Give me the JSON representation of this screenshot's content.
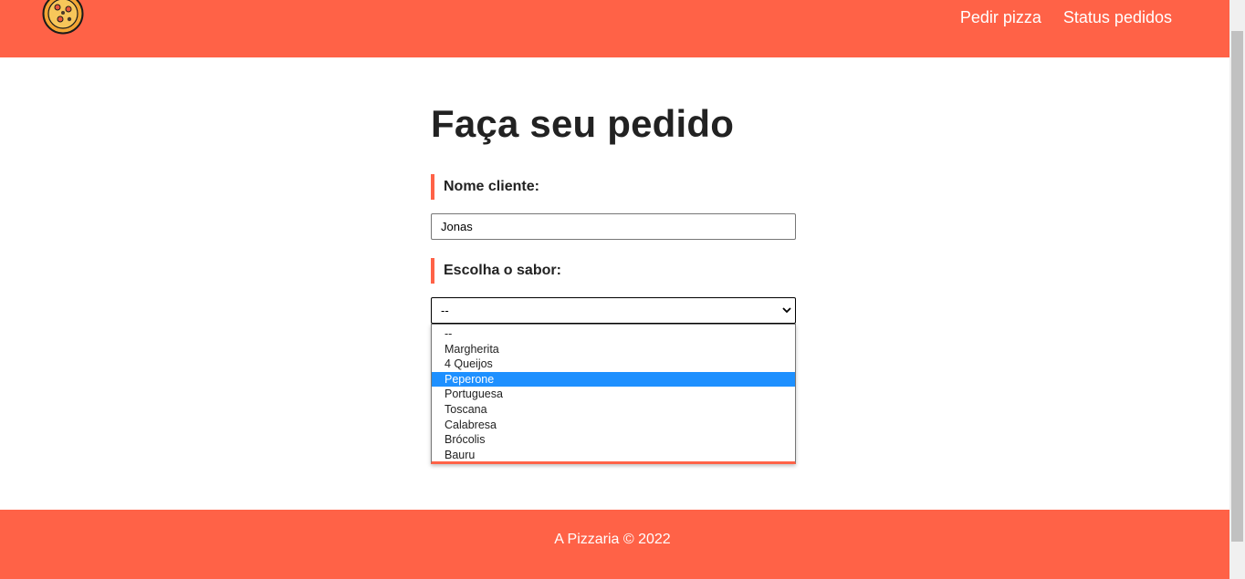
{
  "header": {
    "nav": [
      {
        "label": "Pedir pizza"
      },
      {
        "label": "Status pedidos"
      }
    ],
    "logo_icon": "pizza-icon"
  },
  "form": {
    "title": "Faça seu pedido",
    "name_label": "Nome cliente:",
    "name_value": "Jonas",
    "flavor_label": "Escolha o sabor:",
    "flavor_selected": "--",
    "flavor_options": [
      "--",
      "Margherita",
      "4 Queijos",
      "Peperone",
      "Portuguesa",
      "Toscana",
      "Calabresa",
      "Brócolis",
      "Bauru"
    ],
    "highlighted_option": "Peperone"
  },
  "footer": {
    "text": "A Pizzaria © 2022"
  },
  "colors": {
    "brand": "#ff6247",
    "highlight": "#1e90ff"
  }
}
